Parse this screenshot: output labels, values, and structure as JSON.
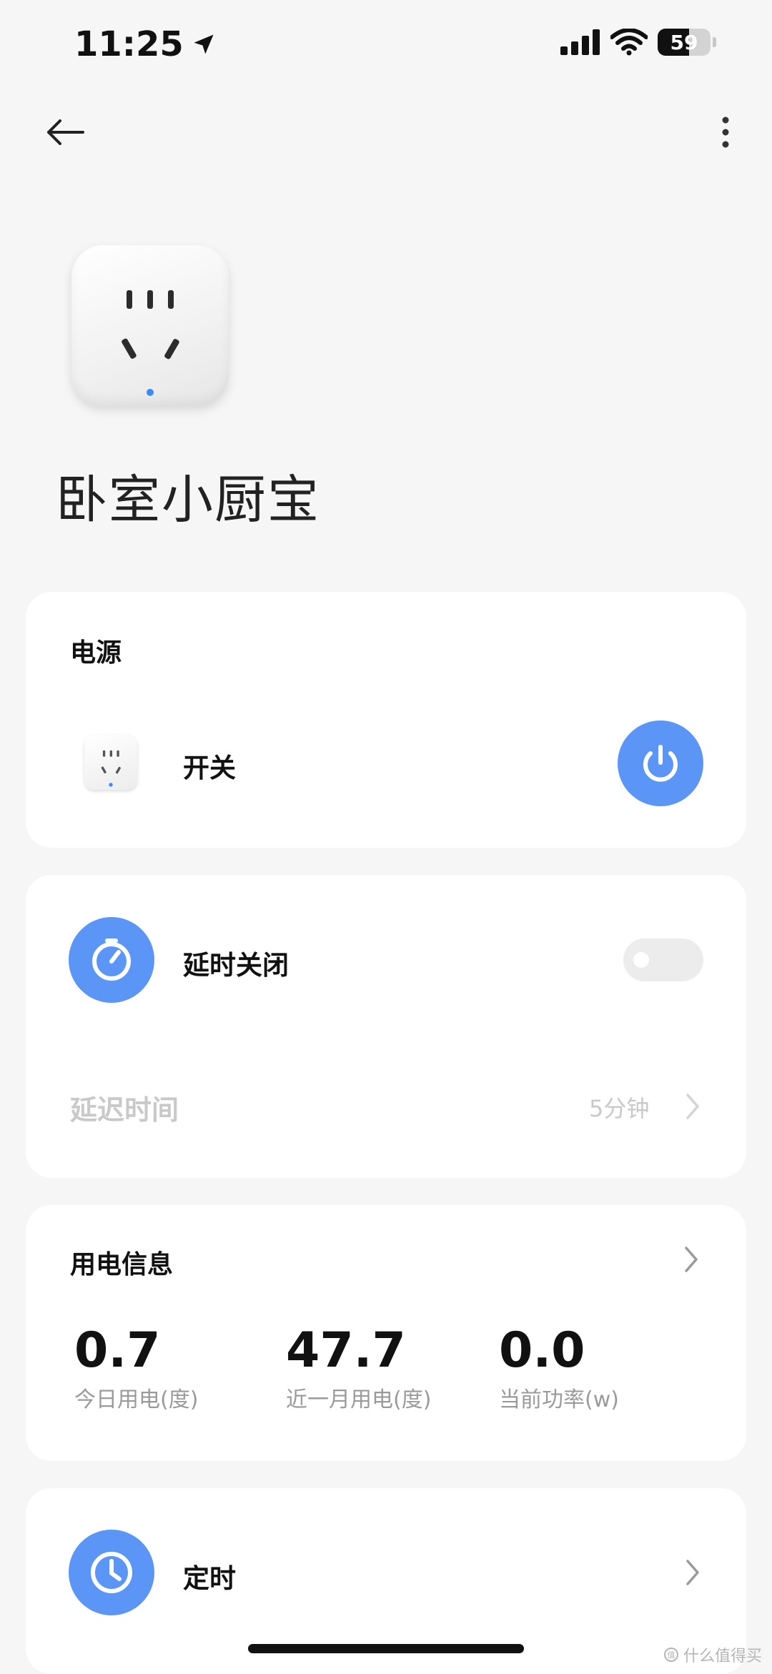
{
  "status_bar": {
    "time": "11:25",
    "battery": "59",
    "battery_level": 0.59,
    "icons": [
      "location-arrow-icon",
      "signal-icon",
      "wifi-icon",
      "battery-icon"
    ]
  },
  "nav": {
    "back_icon": "arrow-left-icon",
    "more_icon": "more-vertical-icon"
  },
  "device": {
    "image": "smart-plug-image",
    "name": "卧室小厨宝"
  },
  "power_card": {
    "title": "电源",
    "switch_label": "开关",
    "switch_icon": "power-icon",
    "is_on": true
  },
  "delay_card": {
    "label": "延时关闭",
    "icon": "timer-icon",
    "enabled": false,
    "delay_label": "延迟时间",
    "delay_value": "5分钟"
  },
  "usage_card": {
    "title": "用电信息",
    "stats": [
      {
        "value": "0.7",
        "label": "今日用电(度)"
      },
      {
        "value": "47.7",
        "label": "近一月用电(度)"
      },
      {
        "value": "0.0",
        "label": "当前功率(w)"
      }
    ]
  },
  "schedule_card": {
    "label": "定时",
    "icon": "clock-icon"
  },
  "watermark": "什么值得买",
  "colors": {
    "accent": "#5b96f6",
    "background": "#f6f6f6",
    "card": "#ffffff",
    "muted": "#c9c9c9"
  }
}
